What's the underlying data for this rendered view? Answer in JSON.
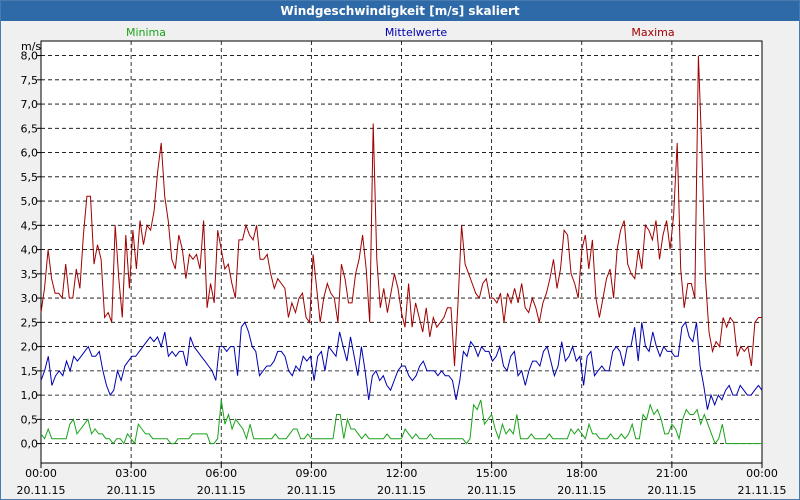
{
  "title": "Windgeschwindigkeit [m/s] skaliert",
  "legend": {
    "min": "Minima",
    "mean": "Mittelwerte",
    "max": "Maxima"
  },
  "colors": {
    "min": "#1aa31a",
    "mean": "#0000b0",
    "max": "#a00000",
    "grid": "#000000",
    "title_bg": "#2f6aa8"
  },
  "chart_data": {
    "type": "line",
    "title": "Windgeschwindigkeit [m/s] skaliert",
    "ylabel": "m/s",
    "ylim": [
      -0.4,
      8.3
    ],
    "yticks": [
      "0,0",
      "0,5",
      "1,0",
      "1,5",
      "2,0",
      "2,5",
      "3,0",
      "3,5",
      "4,0",
      "4,5",
      "5,0",
      "5,5",
      "6,0",
      "6,5",
      "7,0",
      "7,5",
      "8,0"
    ],
    "xlim_hours": [
      0,
      24
    ],
    "xticks": [
      {
        "time": "00:00",
        "date": "20.11.15"
      },
      {
        "time": "03:00",
        "date": "20.11.15"
      },
      {
        "time": "06:00",
        "date": "20.11.15"
      },
      {
        "time": "09:00",
        "date": "20.11.15"
      },
      {
        "time": "12:00",
        "date": "20.11.15"
      },
      {
        "time": "15:00",
        "date": "20.11.15"
      },
      {
        "time": "18:00",
        "date": "20.11.15"
      },
      {
        "time": "21:00",
        "date": "20.11.15"
      },
      {
        "time": "00:00",
        "date": "21.11.15"
      }
    ],
    "grid": true,
    "legend_position": "top",
    "x_step_hours": 0.1667,
    "series": [
      {
        "name": "Maxima",
        "values": [
          2.7,
          3.2,
          4.0,
          3.4,
          3.1,
          3.1,
          3.0,
          3.7,
          3.0,
          3.0,
          3.6,
          3.2,
          4.3,
          5.1,
          5.1,
          3.7,
          4.1,
          3.8,
          2.6,
          2.7,
          2.5,
          4.5,
          3.4,
          2.6,
          4.3,
          3.2,
          4.4,
          3.6,
          4.6,
          4.1,
          4.5,
          4.4,
          4.8,
          5.6,
          6.2,
          5.1,
          4.6,
          3.8,
          3.6,
          4.3,
          4.0,
          3.4,
          3.9,
          3.8,
          3.9,
          3.6,
          4.6,
          2.8,
          3.3,
          2.9,
          4.4,
          4.0,
          3.6,
          3.7,
          3.3,
          3.0,
          4.2,
          4.2,
          4.5,
          4.3,
          4.2,
          4.5,
          3.8,
          3.8,
          3.9,
          3.5,
          3.2,
          3.4,
          3.3,
          3.2,
          2.6,
          2.9,
          2.7,
          3.0,
          3.1,
          2.6,
          2.5,
          3.9,
          3.2,
          2.5,
          3.0,
          3.3,
          3.1,
          3.0,
          2.5,
          3.7,
          3.4,
          2.9,
          2.9,
          3.5,
          3.8,
          4.3,
          3.6,
          2.5,
          6.6,
          3.8,
          2.8,
          3.2,
          2.7,
          3.1,
          3.5,
          3.2,
          2.7,
          2.4,
          3.3,
          2.4,
          2.9,
          2.6,
          2.3,
          2.8,
          2.2,
          2.6,
          2.4,
          2.5,
          2.6,
          2.8,
          2.8,
          1.6,
          2.9,
          4.5,
          3.7,
          3.5,
          3.3,
          3.1,
          3.0,
          3.3,
          3.4,
          3.0,
          3.0,
          2.9,
          3.1,
          2.5,
          3.1,
          2.9,
          3.2,
          2.9,
          3.3,
          2.8,
          2.7,
          3.0,
          2.8,
          2.5,
          2.9,
          3.1,
          3.4,
          3.8,
          3.2,
          3.6,
          4.4,
          4.3,
          3.5,
          3.3,
          3.0,
          4.0,
          4.3,
          3.6,
          4.2,
          3.0,
          2.6,
          3.0,
          3.4,
          3.6,
          3.0,
          4.0,
          4.4,
          4.6,
          3.7,
          3.5,
          3.4,
          4.0,
          3.6,
          4.5,
          4.4,
          4.2,
          4.6,
          3.8,
          4.3,
          4.6,
          4.0,
          4.7,
          6.2,
          3.6,
          2.8,
          3.3,
          3.3,
          3.0,
          8.0,
          6.0,
          3.4,
          2.3,
          1.9,
          2.1,
          2.0,
          2.6,
          2.4,
          2.6,
          2.5,
          1.8,
          2.0,
          1.9,
          2.0,
          1.6,
          2.5,
          2.6,
          2.6
        ]
      },
      {
        "name": "Mittelwerte",
        "values": [
          1.3,
          1.5,
          1.8,
          1.2,
          1.4,
          1.5,
          1.4,
          1.7,
          1.5,
          1.8,
          1.7,
          1.8,
          1.9,
          2.0,
          1.8,
          1.8,
          1.9,
          1.5,
          1.2,
          1.0,
          1.1,
          1.5,
          1.3,
          1.6,
          1.7,
          1.8,
          1.8,
          1.9,
          2.0,
          2.1,
          2.2,
          2.1,
          2.2,
          2.0,
          2.3,
          1.8,
          1.9,
          1.8,
          1.9,
          1.9,
          1.6,
          2.2,
          2.0,
          1.9,
          1.8,
          1.7,
          1.6,
          1.5,
          1.3,
          2.0,
          2.0,
          1.9,
          2.0,
          2.0,
          1.4,
          2.4,
          2.5,
          2.3,
          2.0,
          1.9,
          1.4,
          1.5,
          1.6,
          1.6,
          1.7,
          1.9,
          1.9,
          1.8,
          1.5,
          1.4,
          1.6,
          1.5,
          1.8,
          1.7,
          1.8,
          1.3,
          1.8,
          1.9,
          1.5,
          2.0,
          1.9,
          1.8,
          2.3,
          2.0,
          1.7,
          2.2,
          1.8,
          1.4,
          2.0,
          1.5,
          0.9,
          1.4,
          1.5,
          1.3,
          1.4,
          1.2,
          1.1,
          1.3,
          1.5,
          1.6,
          1.6,
          1.4,
          1.3,
          1.4,
          1.6,
          1.7,
          1.5,
          1.5,
          1.5,
          1.4,
          1.5,
          1.4,
          1.4,
          1.3,
          0.9,
          1.3,
          1.9,
          1.8,
          2.1,
          2.0,
          1.8,
          2.0,
          1.9,
          1.9,
          1.7,
          1.8,
          2.0,
          1.6,
          1.5,
          1.8,
          1.9,
          1.4,
          1.5,
          1.2,
          1.5,
          1.7,
          1.7,
          1.6,
          1.9,
          2.0,
          1.7,
          1.4,
          1.6,
          2.1,
          1.7,
          1.8,
          2.0,
          1.7,
          1.8,
          1.2,
          1.8,
          1.9,
          1.4,
          1.5,
          1.6,
          1.5,
          1.5,
          1.9,
          2.0,
          1.9,
          1.6,
          2.0,
          2.0,
          2.4,
          1.7,
          2.5,
          2.0,
          1.9,
          2.3,
          2.0,
          1.8,
          2.0,
          1.9,
          1.9,
          1.8,
          1.8,
          2.4,
          2.5,
          2.2,
          2.1,
          2.5,
          1.6,
          1.2,
          0.7,
          1.0,
          0.8,
          1.0,
          0.9,
          1.1,
          1.2,
          1.0,
          1.0,
          1.2,
          1.1,
          1.0,
          1.0,
          1.1,
          1.2,
          1.1
        ]
      },
      {
        "name": "Minima",
        "values": [
          0.2,
          0.1,
          0.3,
          0.1,
          0.1,
          0.1,
          0.1,
          0.1,
          0.4,
          0.5,
          0.2,
          0.3,
          0.4,
          0.5,
          0.2,
          0.3,
          0.2,
          0.2,
          0.1,
          0.1,
          0.0,
          0.1,
          0.1,
          0.0,
          0.2,
          0.1,
          0.0,
          0.4,
          0.3,
          0.2,
          0.2,
          0.1,
          0.1,
          0.1,
          0.1,
          0.1,
          0.0,
          0.0,
          0.1,
          0.1,
          0.1,
          0.1,
          0.2,
          0.2,
          0.2,
          0.2,
          0.2,
          0.0,
          0.0,
          0.1,
          0.9,
          0.4,
          0.6,
          0.3,
          0.5,
          0.4,
          0.3,
          0.1,
          0.4,
          0.1,
          0.1,
          0.1,
          0.1,
          0.1,
          0.1,
          0.2,
          0.1,
          0.1,
          0.1,
          0.2,
          0.3,
          0.3,
          0.1,
          0.1,
          0.2,
          0.1,
          0.1,
          0.1,
          0.1,
          0.1,
          0.1,
          0.1,
          0.6,
          0.6,
          0.1,
          0.5,
          0.3,
          0.3,
          0.2,
          0.1,
          0.2,
          0.1,
          0.1,
          0.1,
          0.1,
          0.1,
          0.2,
          0.1,
          0.1,
          0.1,
          0.1,
          0.3,
          0.2,
          0.1,
          0.2,
          0.1,
          0.1,
          0.1,
          0.2,
          0.1,
          0.1,
          0.1,
          0.1,
          0.1,
          0.1,
          0.1,
          0.1,
          0.1,
          0.0,
          0.1,
          0.8,
          0.7,
          0.9,
          0.4,
          0.5,
          0.6,
          0.3,
          0.1,
          0.4,
          0.2,
          0.3,
          0.2,
          0.6,
          0.1,
          0.1,
          0.1,
          0.2,
          0.1,
          0.1,
          0.1,
          0.1,
          0.2,
          0.1,
          0.1,
          0.1,
          0.1,
          0.1,
          0.3,
          0.2,
          0.3,
          0.2,
          0.1,
          0.4,
          0.2,
          0.2,
          0.1,
          0.1,
          0.1,
          0.2,
          0.1,
          0.1,
          0.2,
          0.1,
          0.2,
          0.4,
          0.1,
          0.1,
          0.6,
          0.5,
          0.8,
          0.6,
          0.7,
          0.5,
          0.2,
          0.2,
          0.4,
          0.3,
          0.1,
          0.5,
          0.7,
          0.6,
          0.6,
          0.7,
          0.4,
          0.6,
          0.4,
          0.2,
          0.0,
          0.1,
          0.4,
          0.0,
          0.0,
          0.0,
          0.0,
          0.0,
          0.0,
          0.0,
          0.0,
          0.0,
          0.0,
          0.0
        ]
      }
    ]
  }
}
